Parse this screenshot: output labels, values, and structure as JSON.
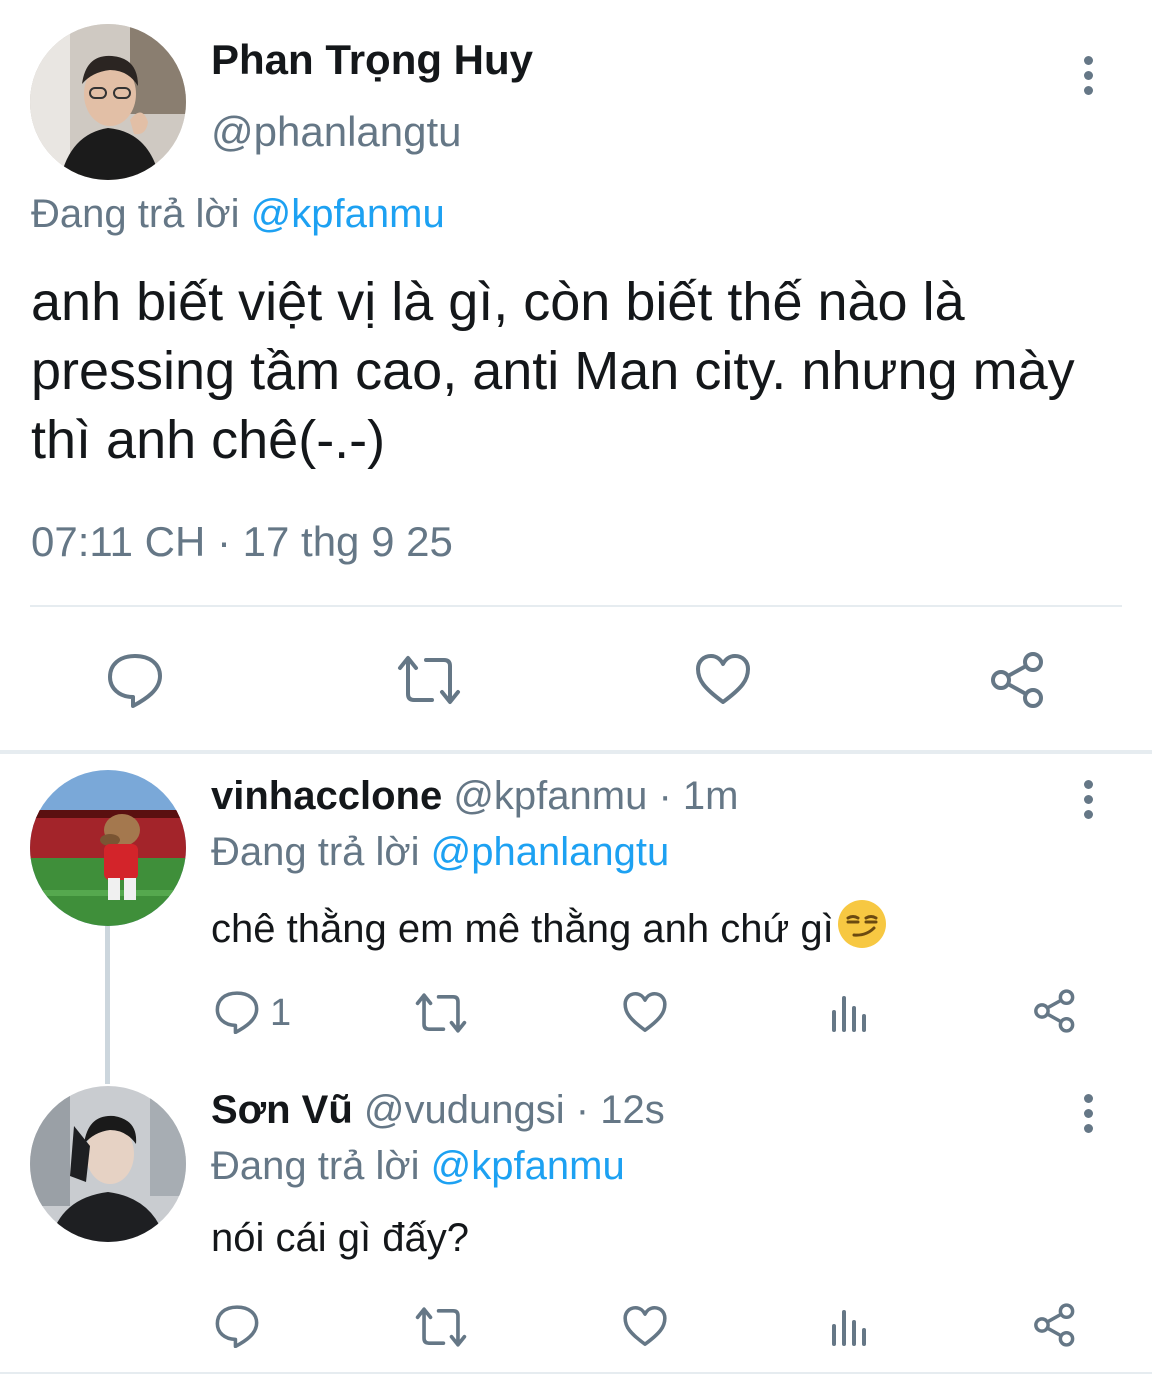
{
  "main_tweet": {
    "author_name": "Phan Trọng Huy",
    "author_handle": "@phanlangtu",
    "replying_prefix": "Đang trả lời",
    "replying_to": "@kpfanmu",
    "text": "anh biết việt vị là gì, còn biết thế nào là pressing tầm cao, anti Man city. nhưng mày thì anh chê(-.-)",
    "timestamp": "07:11 CH · 17 thg 9 25",
    "actions": [
      "reply-icon",
      "retweet-icon",
      "like-icon",
      "share-icon"
    ]
  },
  "replies": [
    {
      "author_name": "vinhacclone",
      "author_handle": "@kpfanmu",
      "time": "1m",
      "replying_prefix": "Đang trả lời",
      "replying_to": "@phanlangtu",
      "text": " chê thằng em mê thằng anh chứ gì",
      "emoji": "smirk-emoji",
      "reply_count": "1",
      "actions": [
        "reply-icon",
        "retweet-icon",
        "like-icon",
        "analytics-icon",
        "share-icon"
      ]
    },
    {
      "author_name": "Sơn Vũ",
      "author_handle": "@vudungsi",
      "time": "12s",
      "replying_prefix": "Đang trả lời",
      "replying_to": "@kpfanmu",
      "text": "nói cái gì đấy?",
      "actions": [
        "reply-icon",
        "retweet-icon",
        "like-icon",
        "analytics-icon",
        "share-icon"
      ]
    }
  ],
  "colors": {
    "accent": "#1da1f2",
    "secondary_text": "#657786",
    "primary_text": "#14171a",
    "divider": "#e6ecf0"
  }
}
